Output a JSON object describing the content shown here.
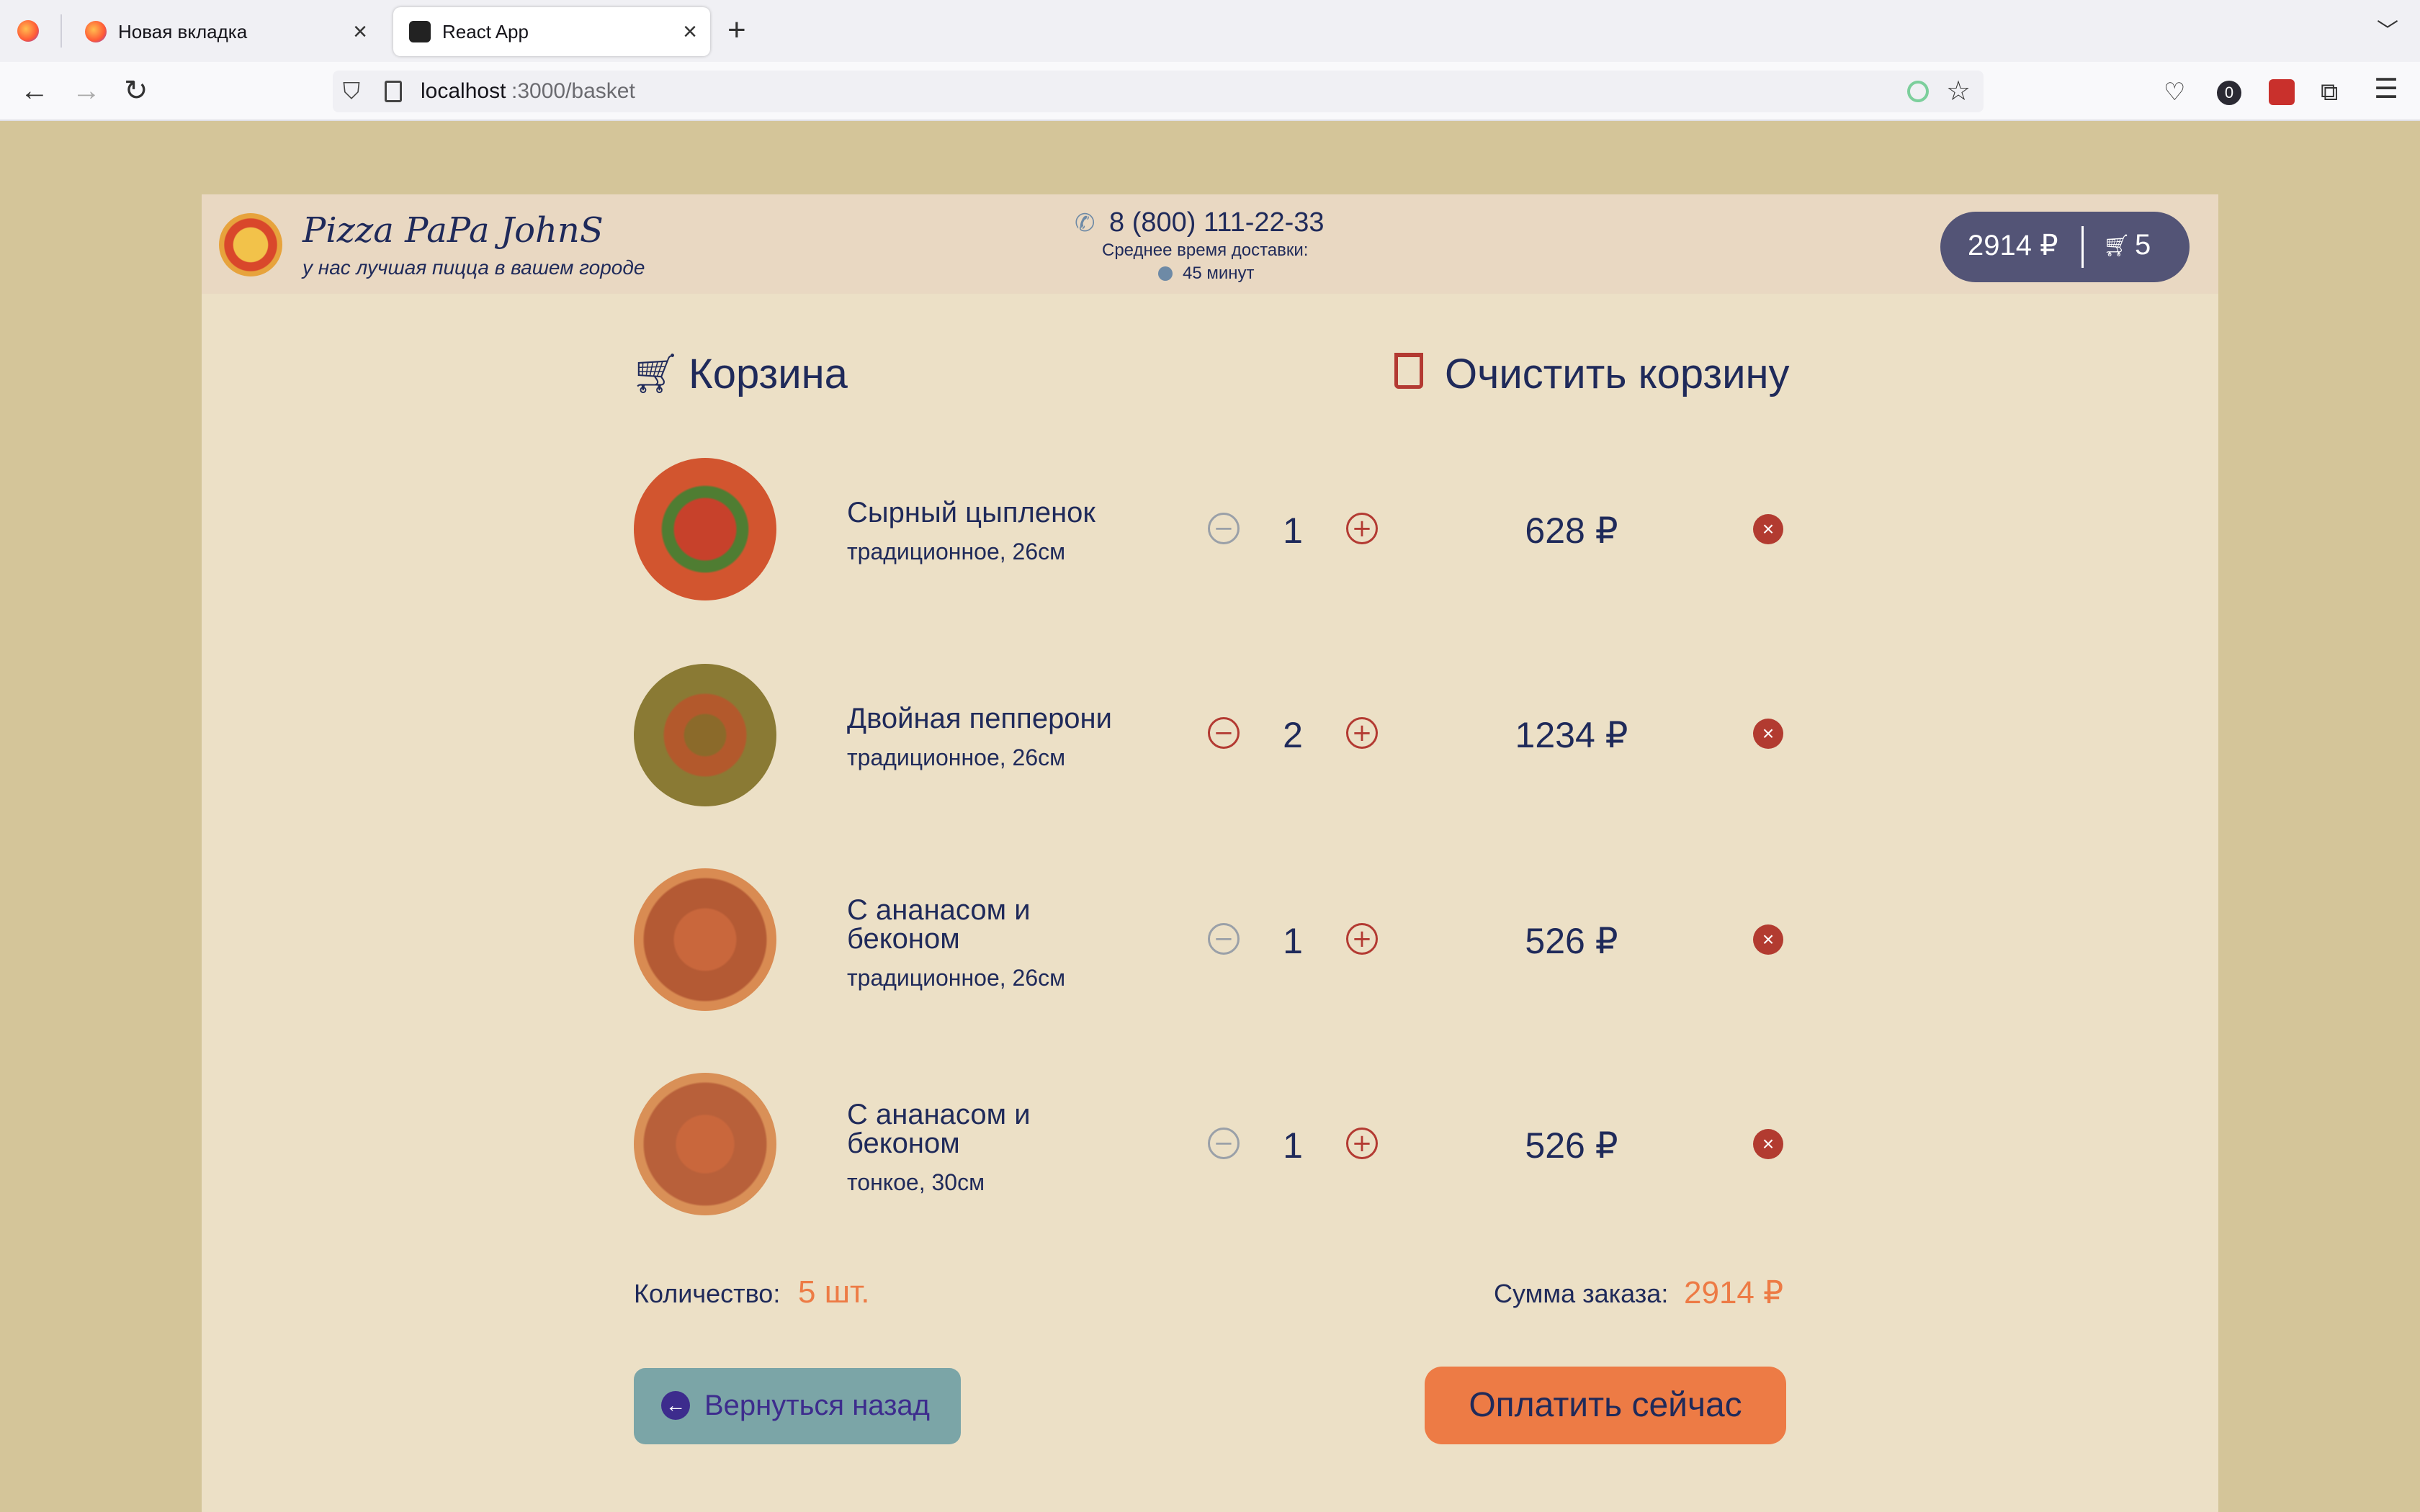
{
  "browser": {
    "tabs": [
      {
        "title": "Новая вкладка"
      },
      {
        "title": "React App"
      }
    ],
    "url": {
      "host": "localhost",
      "path": ":3000/basket"
    },
    "badge_count": "0"
  },
  "header": {
    "brand": "Pizza PaPa JohnS",
    "tagline": "у нас лучшая пицца в вашем городе",
    "phone": "8 (800) 111-22-33",
    "delivery_label": "Среднее время доставки:",
    "delivery_time": "45 минут",
    "cart_total": "2914 ₽",
    "cart_count": "5"
  },
  "basket": {
    "title": "Корзина",
    "clear_label": "Очистить корзину",
    "items": [
      {
        "name_1": "Сырный цыпленок",
        "name_2": "",
        "details": "традиционное, 26см",
        "qty": "1",
        "price": "628 ₽"
      },
      {
        "name_1": "Двойная пепперони",
        "name_2": "",
        "details": "традиционное, 26см",
        "qty": "2",
        "price": "1234 ₽"
      },
      {
        "name_1": "С ананасом и",
        "name_2": "беконом",
        "details": "традиционное, 26см",
        "qty": "1",
        "price": "526 ₽"
      },
      {
        "name_1": "С ананасом и",
        "name_2": "беконом",
        "details": "тонкое, 30см",
        "qty": "1",
        "price": "526 ₽"
      }
    ],
    "quantity_label": "Количество:",
    "quantity_value": "5 шт.",
    "sum_label": "Сумма заказа:",
    "sum_value": "2914 ₽",
    "back_label": "Вернуться назад",
    "pay_label": "Оплатить сейчас"
  },
  "colors": {
    "accent": "#ed7b45",
    "back_button": "#7ba5a7",
    "remove": "#b23b30",
    "text": "#1f2a5a"
  }
}
